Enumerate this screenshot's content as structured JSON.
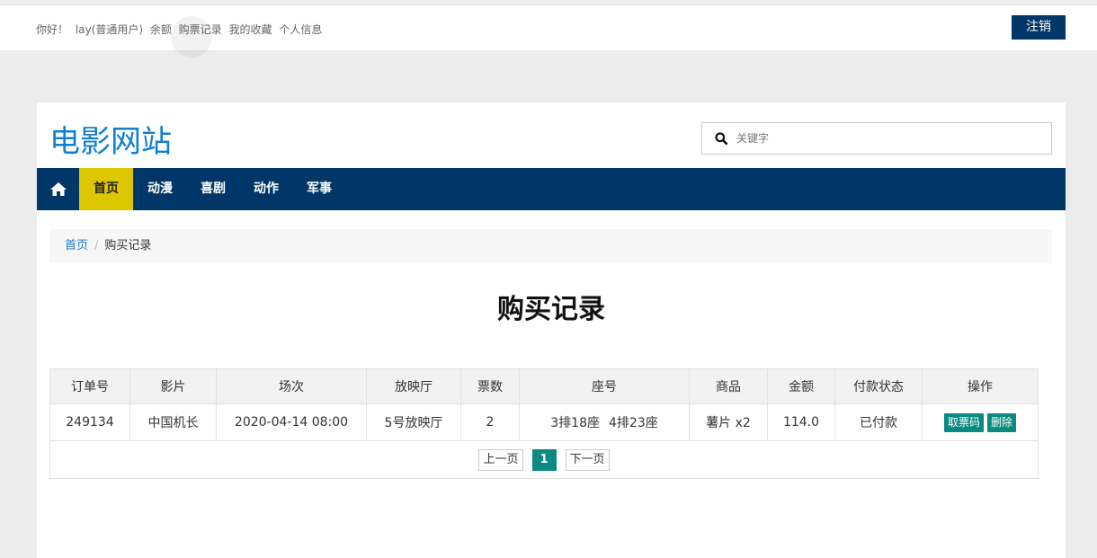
{
  "topbar": {
    "greeting": "你好！",
    "user": "lay(普通用户)",
    "balance": "余额",
    "links": [
      "购票记录",
      "我的收藏",
      "个人信息"
    ],
    "logout_label": "注销"
  },
  "site": {
    "title": "电影网站"
  },
  "search": {
    "placeholder": "关键字",
    "value": ""
  },
  "nav": {
    "items": [
      "首页",
      "动漫",
      "喜剧",
      "动作",
      "军事"
    ],
    "active": "首页"
  },
  "breadcrumb": {
    "home": "首页",
    "separator": "/",
    "current": "购买记录"
  },
  "page": {
    "heading": "购买记录"
  },
  "table": {
    "columns": [
      "订单号",
      "影片",
      "场次",
      "放映厅",
      "票数",
      "座号",
      "商品",
      "金额",
      "付款状态",
      "操作"
    ],
    "rows": [
      {
        "order_no": "249134",
        "movie": "中国机长",
        "showtime": "2020-04-14 08:00",
        "hall": "5号放映厅",
        "tickets": "2",
        "seats": [
          "3排18座",
          "4排23座"
        ],
        "goods": "薯片 x2",
        "amount": "114.0",
        "status": "已付款",
        "actions": [
          "取票码",
          "删除"
        ]
      }
    ]
  },
  "pager": {
    "prev": "上一页",
    "current": "1",
    "next": "下一页"
  },
  "colors": {
    "nav_bg": "#003768",
    "nav_active": "#dcc701",
    "title": "#0e7fd1",
    "action_btn": "#0a8a80"
  }
}
